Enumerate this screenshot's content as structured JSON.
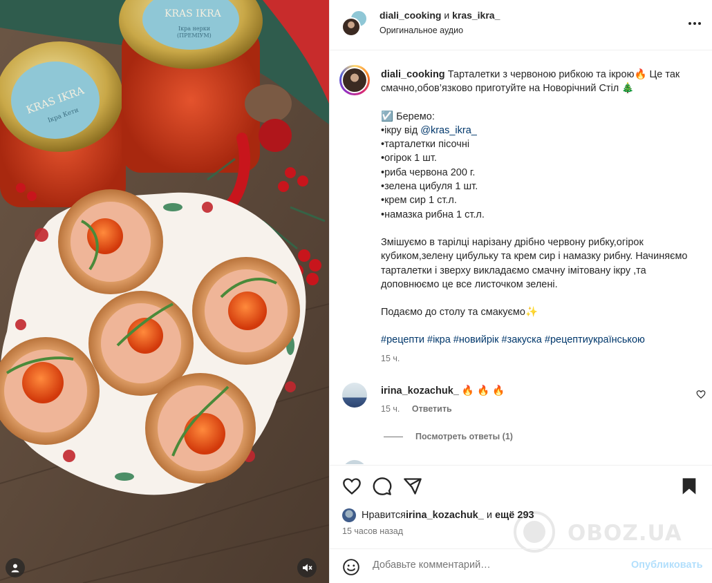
{
  "header": {
    "user1": "diali_cooking",
    "conj": "и",
    "user2": "kras_ikra_",
    "audio": "Оригинальное аудио"
  },
  "caption": {
    "username": "diali_cooking",
    "intro": "Тарталетки з червоною рибкою та ікрою🔥 Це так смачно,обов’язково приготуйте на Новорічний Стіл 🎄",
    "take_label": "☑️ Беремо:",
    "ing_prefix": "•ікру від ",
    "ing_mention": "@kras_ikra_",
    "ingredients": [
      "•тарталетки пісочні",
      "•огірок 1 шт.",
      "•риба червона 200 г.",
      "•зелена цибуля 1 шт.",
      "•крем сир 1 ст.л.",
      "•намазка рибна 1 ст.л."
    ],
    "method": "Змішуємо в тарілці нарізану дрібно червону рибку,огірок кубиком,зелену цибульку та крем сир і намазку рибну. Начиняємо тарталетки і зверху викладаємо смачну імітовану ікру ,та доповнюємо це все листочком зелені.",
    "serve": "Подаємо до столу та смакуємо✨",
    "hashtags": "#рецепти #ікра #новийрік #закуска #рецептиукраїнською",
    "age": "15 ч."
  },
  "comment": {
    "username": "irina_kozachuk_",
    "text": "🔥 🔥 🔥",
    "age": "15 ч.",
    "reply_label": "Ответить",
    "view_replies": "Посмотреть ответы (1)"
  },
  "likes": {
    "prefix": "Нравится ",
    "user": "irina_kozachuk_",
    "middle": " и ",
    "rest": "ещё 293"
  },
  "time_ago": "15 часов назад",
  "comment_box": {
    "placeholder": "Добавьте комментарий…",
    "post_label": "Опубликовать"
  },
  "photo_labels": {
    "jar_brand": "KRAS IKRA",
    "jar_left_sub": "Ікра Кети",
    "jar_right_sub": "Ікра нерки",
    "jar_right_sub2": "(ПРЕМІУМ)"
  },
  "watermark": "OBOZ.UA",
  "colors": {
    "link": "#00376b",
    "secondary": "#737373",
    "post_disabled": "#b2dffc",
    "border": "#efefef"
  }
}
